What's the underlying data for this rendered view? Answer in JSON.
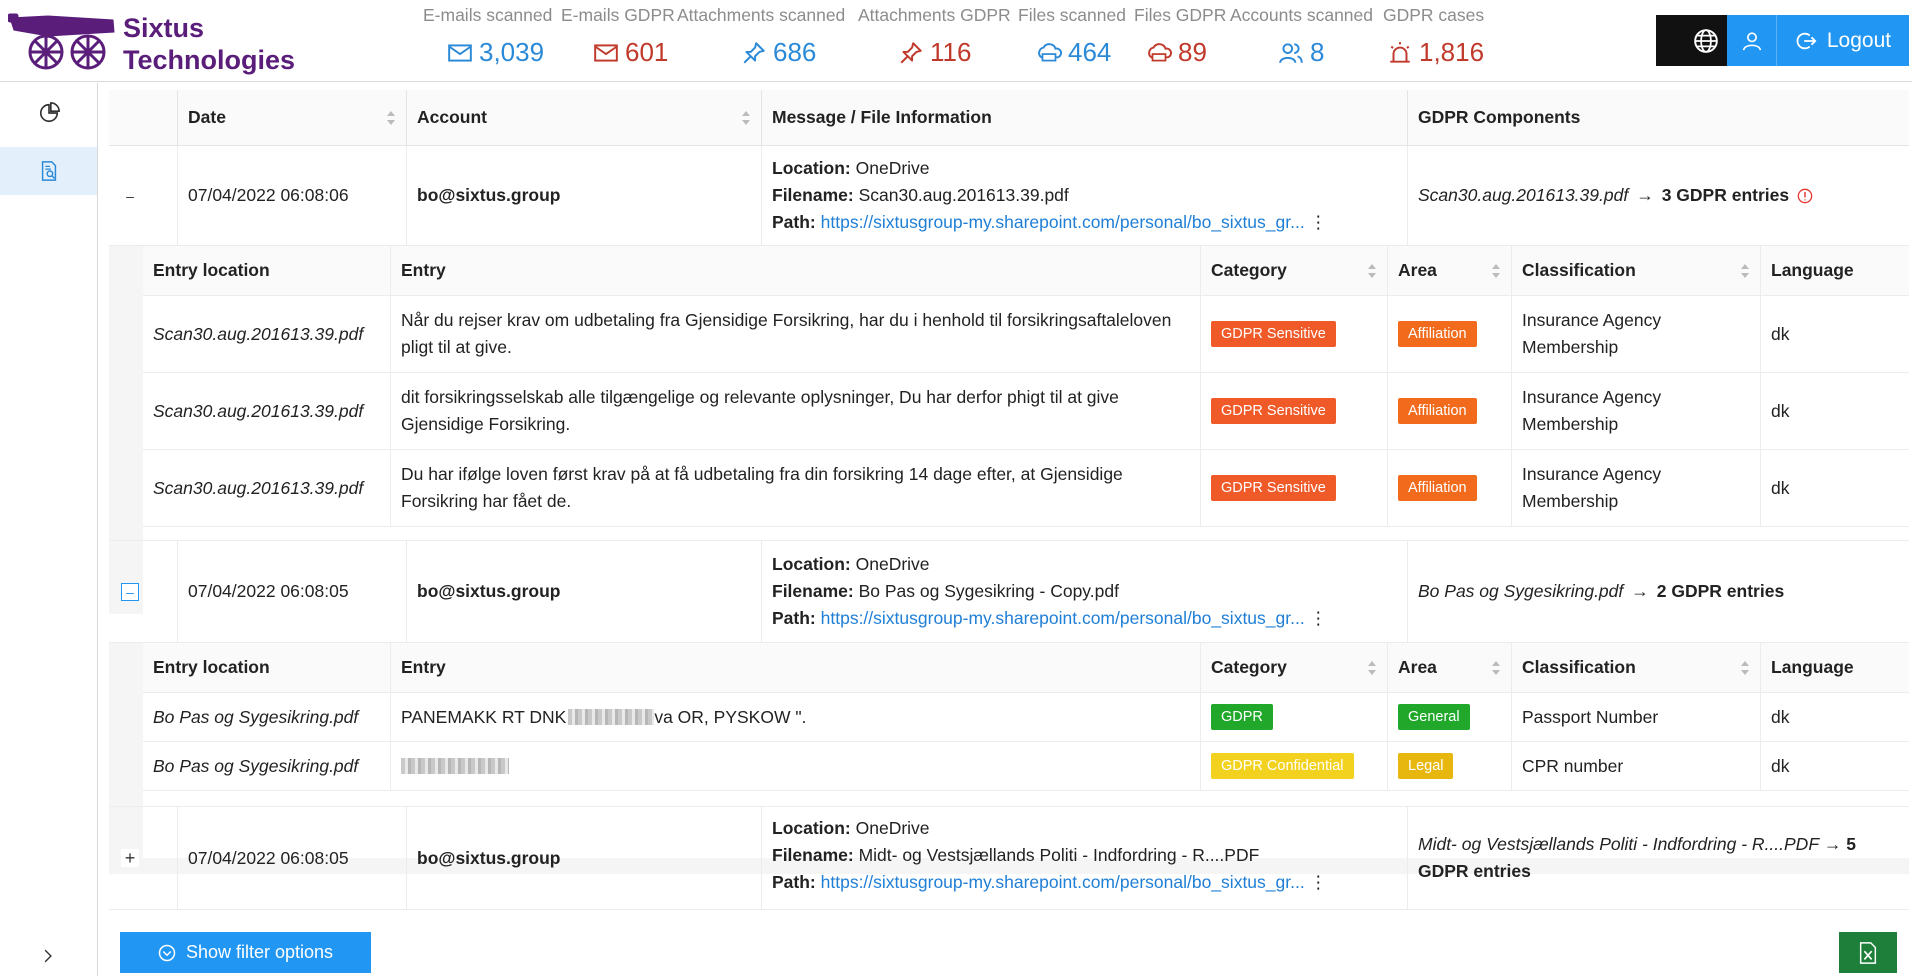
{
  "brand": {
    "line1": "Sixtus",
    "line2": "Technologies"
  },
  "stats": [
    {
      "label": "E-mails scanned",
      "value": "3,039",
      "icon": "mail-icon",
      "color": "blue"
    },
    {
      "label": "E-mails GDPR",
      "value": "601",
      "icon": "mail-icon",
      "color": "red"
    },
    {
      "label": "Attachments scanned",
      "value": "686",
      "icon": "pin-icon",
      "color": "blue"
    },
    {
      "label": "Attachments GDPR",
      "value": "116",
      "icon": "pin-icon",
      "color": "red"
    },
    {
      "label": "Files scanned",
      "value": "464",
      "icon": "cloud-drive-icon",
      "color": "blue"
    },
    {
      "label": "Files GDPR",
      "value": "89",
      "icon": "cloud-drive-icon",
      "color": "red"
    },
    {
      "label": "Accounts scanned",
      "value": "8",
      "icon": "users-icon",
      "color": "blue"
    },
    {
      "label": "GDPR cases",
      "value": "1,816",
      "icon": "alarm-icon",
      "color": "red"
    }
  ],
  "header_buttons": {
    "logout_label": "Logout"
  },
  "table": {
    "columns": {
      "date": "Date",
      "account": "Account",
      "message": "Message / File Information",
      "gdpr": "GDPR Components"
    },
    "sub_columns": {
      "entry_location": "Entry location",
      "entry": "Entry",
      "category": "Category",
      "area": "Area",
      "classification": "Classification",
      "language": "Language"
    },
    "labels": {
      "location": "Location:",
      "filename": "Filename:",
      "path": "Path:"
    },
    "rows": [
      {
        "expander": "–",
        "date": "07/04/2022 06:08:06",
        "account": "bo@sixtus.group",
        "location": "OneDrive",
        "filename": "Scan30.aug.201613.39.pdf",
        "path": "https://sixtusgroup-my.sharepoint.com/personal/bo_sixtus_gr...",
        "gdpr_file": "Scan30.aug.201613.39.pdf",
        "gdpr_entries": "3 GDPR entries",
        "entries": [
          {
            "location": "Scan30.aug.201613.39.pdf",
            "entry": "Når du rejser krav om udbetaling fra Gjensidige Forsikring, har du i henhold til forsikringsaftaleloven pligt til at give.",
            "category": "GDPR Sensitive",
            "area": "Affiliation",
            "classification": "Insurance Agency Membership",
            "language": "dk"
          },
          {
            "location": "Scan30.aug.201613.39.pdf",
            "entry": "dit forsikringsselskab alle tilgængelige og relevante oplysninger, Du har derfor phigt til at give Gjensidige Forsikring.",
            "category": "GDPR Sensitive",
            "area": "Affiliation",
            "classification": "Insurance Agency Membership",
            "language": "dk"
          },
          {
            "location": "Scan30.aug.201613.39.pdf",
            "entry": "Du har ifølge loven først krav på at få udbetaling fra din forsikring 14 dage efter, at Gjensidige Forsikring har fået de.",
            "category": "GDPR Sensitive",
            "area": "Affiliation",
            "classification": "Insurance Agency Membership",
            "language": "dk"
          }
        ]
      },
      {
        "expander": "–",
        "date": "07/04/2022 06:08:05",
        "account": "bo@sixtus.group",
        "location": "OneDrive",
        "filename": "Bo Pas og Sygesikring - Copy.pdf",
        "path": "https://sixtusgroup-my.sharepoint.com/personal/bo_sixtus_gr...",
        "gdpr_file": "Bo Pas og Sygesikring.pdf",
        "gdpr_entries": "2 GDPR entries",
        "entries": [
          {
            "location": "Bo Pas og Sygesikring.pdf",
            "entry_prefix": "PANEMAKK RT DNK",
            "entry_suffix": " va OR, PYSKOW \".",
            "category": "GDPR",
            "area": "General",
            "classification": "Passport Number",
            "language": "dk"
          },
          {
            "location": "Bo Pas og Sygesikring.pdf",
            "entry_prefix": "",
            "entry_suffix": "",
            "category": "GDPR Confidential",
            "area": "Legal",
            "classification": "CPR number",
            "language": "dk"
          }
        ]
      },
      {
        "expander": "+",
        "date": "07/04/2022 06:08:05",
        "account": "bo@sixtus.group",
        "location": "OneDrive",
        "filename": "Midt- og Vestsjællands Politi - Indfordring - R....PDF",
        "path": "https://sixtusgroup-my.sharepoint.com/personal/bo_sixtus_gr...",
        "gdpr_file": "Midt- og Vestsjællands Politi - Indfordring - R....PDF",
        "gdpr_entries_num": "5",
        "gdpr_entries": "GDPR entries"
      }
    ]
  },
  "footer": {
    "filter_label": "Show filter options"
  },
  "colors": {
    "accent": "#2196f3",
    "brand": "#5a1d7a",
    "red": "#c0392b",
    "orange": "#f05a28",
    "green": "#21a82b",
    "yellow": "#f3d21f",
    "excel": "#1e7f3a"
  }
}
